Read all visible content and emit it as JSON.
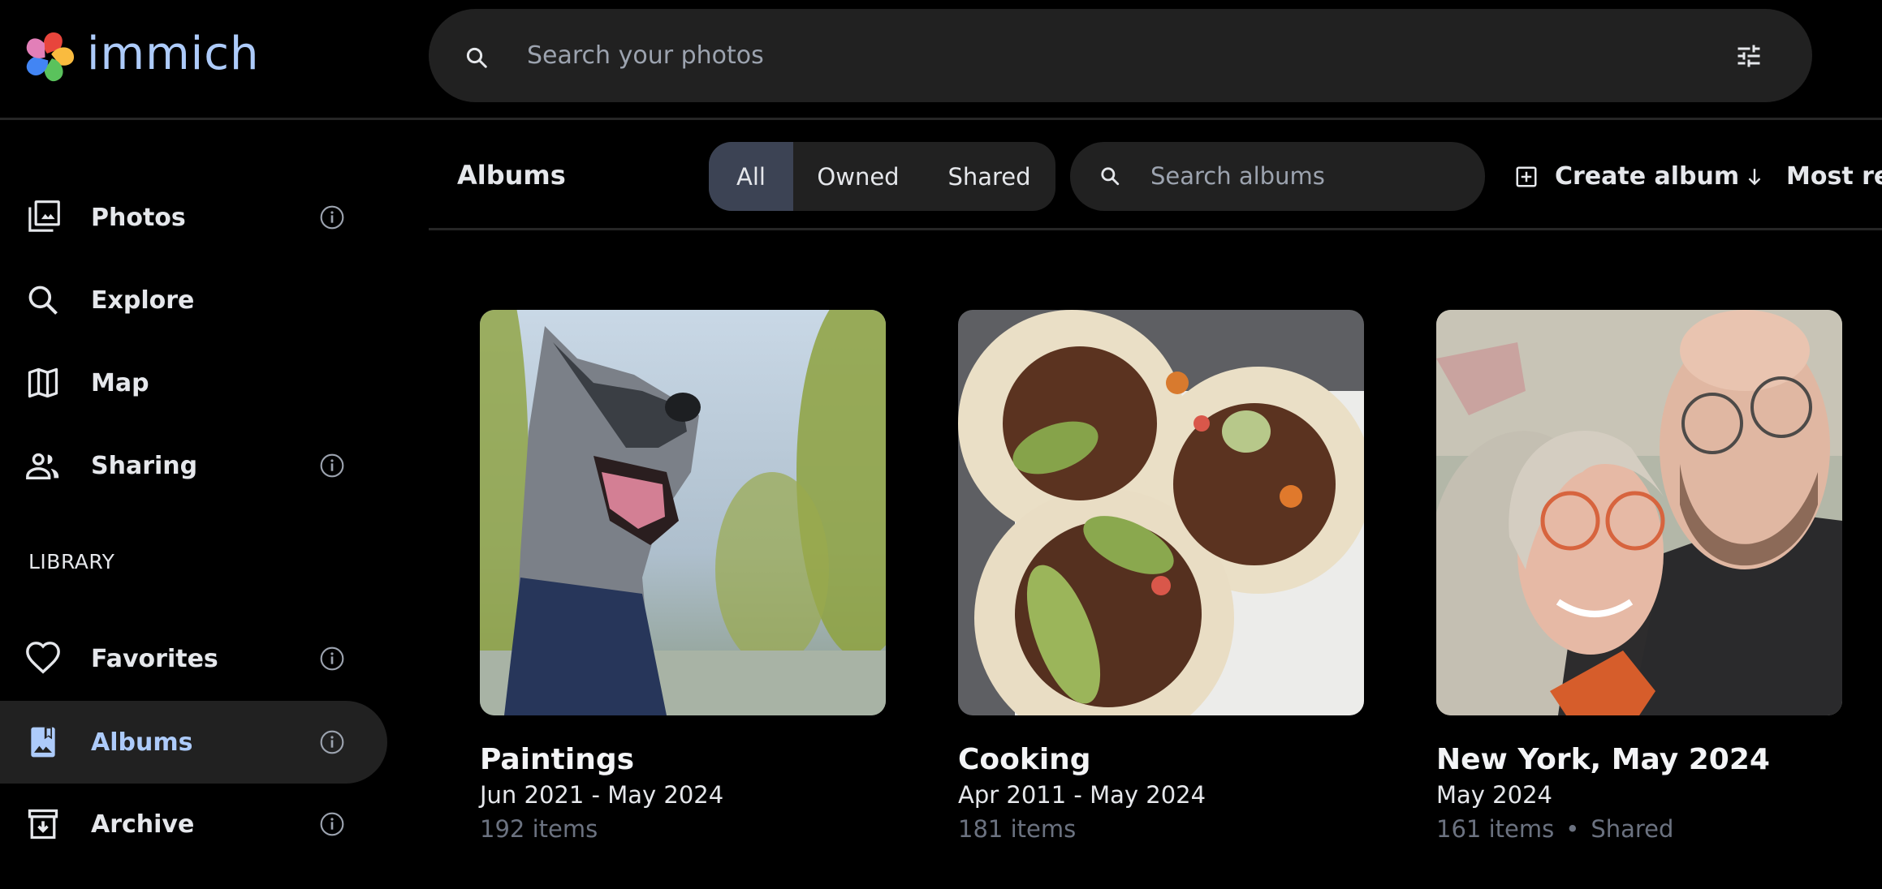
{
  "app": {
    "name": "immich",
    "brand_color": "#adcbfa",
    "logo_colors": [
      "#e8453c",
      "#f9bb3f",
      "#5ac25c",
      "#4285f4",
      "#e27fb8"
    ]
  },
  "search": {
    "placeholder": "Search your photos",
    "search_icon": "search-icon",
    "filter_icon": "tune-icon"
  },
  "sidebar": {
    "items": [
      {
        "label": "Photos",
        "icon": "photos-icon",
        "info": true,
        "active": false
      },
      {
        "label": "Explore",
        "icon": "explore-icon",
        "info": false,
        "active": false
      },
      {
        "label": "Map",
        "icon": "map-icon",
        "info": false,
        "active": false
      },
      {
        "label": "Sharing",
        "icon": "sharing-icon",
        "info": true,
        "active": false
      }
    ],
    "library_label": "LIBRARY",
    "library_items": [
      {
        "label": "Favorites",
        "icon": "heart-icon",
        "info": true,
        "active": false
      },
      {
        "label": "Albums",
        "icon": "albums-icon",
        "info": true,
        "active": true
      },
      {
        "label": "Archive",
        "icon": "archive-icon",
        "info": true,
        "active": false
      }
    ]
  },
  "toolbar": {
    "title": "Albums",
    "filters": [
      {
        "label": "All",
        "active": true
      },
      {
        "label": "Owned",
        "active": false
      },
      {
        "label": "Shared",
        "active": false
      }
    ],
    "album_search_placeholder": "Search albums",
    "create_label": "Create album",
    "sort_label": "Most recent photo"
  },
  "albums": [
    {
      "title": "Paintings",
      "date": "Jun 2021 - May 2024",
      "count": "192 items",
      "shared": ""
    },
    {
      "title": "Cooking",
      "date": "Apr 2011 - May 2024",
      "count": "181 items",
      "shared": ""
    },
    {
      "title": "New York, May 2024",
      "date": "May 2024",
      "count": "161 items",
      "shared": "Shared",
      "separator": "•"
    }
  ]
}
